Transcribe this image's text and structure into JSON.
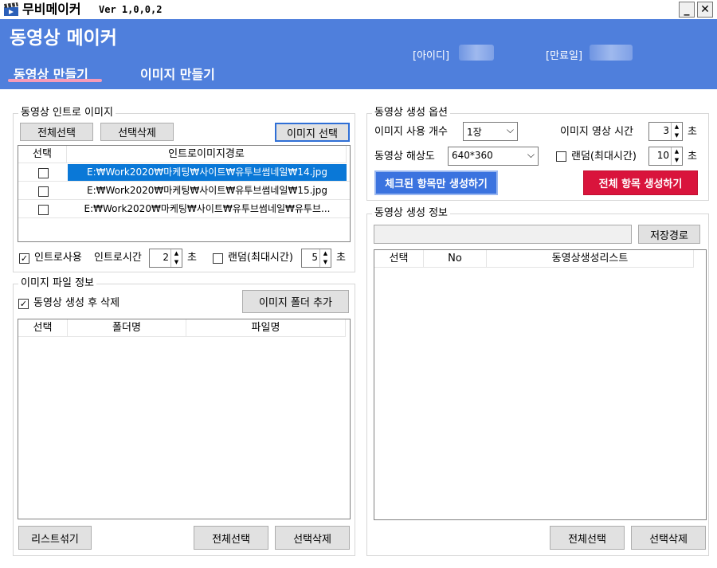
{
  "titlebar": {
    "app_name": "무비메이커",
    "version": "Ver 1,0,0,2",
    "minimize": "_",
    "close": "✕"
  },
  "header": {
    "title": "동영상 메이커",
    "id_label": "[아이디]",
    "expire_label": "[만료일]",
    "tabs": [
      "동영상 만들기",
      "이미지 만들기"
    ]
  },
  "intro": {
    "group_title": "동영상 인트로 이미지",
    "select_all": "전체선택",
    "delete_selected": "선택삭제",
    "select_image": "이미지 선택",
    "columns": [
      "선택",
      "인트로이미지경로"
    ],
    "rows": [
      "E:₩Work2020₩마케팅₩사이트₩유투브썸네일₩14.jpg",
      "E:₩Work2020₩마케팅₩사이트₩유투브썸네일₩15.jpg",
      "E:₩Work2020₩마케팅₩사이트₩유투브썸네일₩유투브..."
    ],
    "use_intro": "인트로사용",
    "intro_time_label": "인트로시간",
    "intro_time": "2",
    "sec1": "초",
    "random_label": "랜덤(최대시간)",
    "random_value": "5",
    "sec2": "초"
  },
  "imagefile": {
    "group_title": "이미지 파일 정보",
    "delete_after": "동영상 생성 후 삭제",
    "add_folder": "이미지 폴더 추가",
    "columns": [
      "선택",
      "폴더명",
      "파일명"
    ],
    "shuffle": "리스트섞기",
    "select_all": "전체선택",
    "delete_selected": "선택삭제"
  },
  "options": {
    "group_title": "동영상 생성 옵션",
    "image_count_label": "이미지 사용 개수",
    "image_count": "1장",
    "image_time_label": "이미지 영상 시간",
    "image_time": "3",
    "sec1": "초",
    "resolution_label": "동영상 해상도",
    "resolution": "640*360",
    "random_label": "랜덤(최대시간)",
    "random_value": "10",
    "sec2": "초",
    "create_checked": "체크된 항목만 생성하기",
    "create_all": "전체 항목 생성하기"
  },
  "info": {
    "group_title": "동영상 생성 정보",
    "save_path": "저장경로",
    "columns": [
      "선택",
      "No",
      "동영상생성리스트"
    ],
    "select_all": "전체선택",
    "delete_selected": "선택삭제"
  },
  "colors": {
    "header_bg": "#4f7fdc",
    "tab_underline": "#f59ab8",
    "selected_row": "#0a78d7",
    "create_checked_bg": "#3b73df",
    "create_all_bg": "#d9143c"
  }
}
